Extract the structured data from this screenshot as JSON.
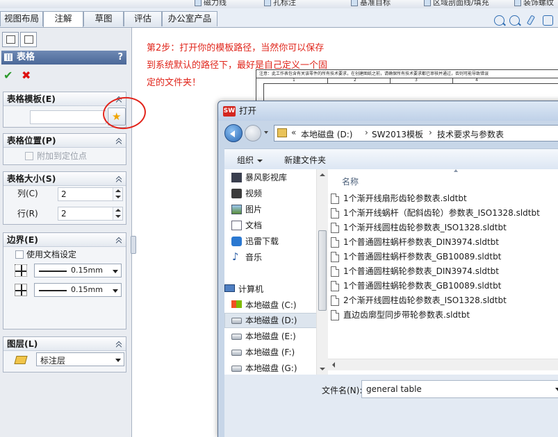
{
  "top_bar": {
    "commands": [
      "磁力线",
      "孔标注",
      "基准目标",
      "区域剖面线/填充",
      "装饰螺纹线"
    ],
    "tabs": [
      {
        "label": "视图布局",
        "active": false
      },
      {
        "label": "注解",
        "active": true
      },
      {
        "label": "草图",
        "active": false
      },
      {
        "label": "评估",
        "active": false
      },
      {
        "label": "办公室产品",
        "active": false
      }
    ]
  },
  "property_manager": {
    "title": "表格",
    "help": "?",
    "ok_icon": "✔",
    "cancel_icon": "✖",
    "groups": {
      "template": {
        "title": "表格模板(E)"
      },
      "position": {
        "title": "表格位置(P)",
        "attach_label": "附加到定位点",
        "attach_checked": false
      },
      "size": {
        "title": "表格大小(S)",
        "cols_label": "列(C)",
        "cols_value": "2",
        "rows_label": "行(R)",
        "rows_value": "2"
      },
      "border": {
        "title": "边界(E)",
        "use_doc_label": "使用文档设定",
        "use_doc_checked": false,
        "outer_value": "0.15mm",
        "inner_value": "0.15mm"
      },
      "layer": {
        "title": "图层(L)",
        "value": "标注层"
      }
    }
  },
  "annotation": {
    "note": "第2步：打开你的模板路径，当然你可以保存到系统默认的路径下，最好是自己定义一个固定的文件夹！",
    "highlight_color": "#e2231a"
  },
  "sheet": {
    "header_text": "注意：此工作表包含有关该零件的所有技术要求，在创建图纸之前，请确保所有技术要求都已审核并通过，否则可能导致错误",
    "ruler": [
      "1",
      "2",
      "3",
      "4"
    ]
  },
  "dialog": {
    "title": "打开",
    "app_badge": "SW",
    "breadcrumbs": [
      "本地磁盘 (D:)",
      "SW2013模板",
      "技术要求与参数表"
    ],
    "crumb_prefix": "«",
    "crumb_sep": "›",
    "organize_label": "组织",
    "new_folder_label": "新建文件夹",
    "nav": {
      "favorites": [
        {
          "label": "暴风影视库",
          "icon": "storm-video-icon"
        },
        {
          "label": "视频",
          "icon": "video-icon"
        },
        {
          "label": "图片",
          "icon": "picture-icon"
        },
        {
          "label": "文档",
          "icon": "document-icon"
        },
        {
          "label": "迅雷下载",
          "icon": "thunder-download-icon"
        },
        {
          "label": "音乐",
          "icon": "music-icon"
        }
      ],
      "computer": "计算机",
      "drives": [
        {
          "label": "本地磁盘 (C:)",
          "selected": false
        },
        {
          "label": "本地磁盘 (D:)",
          "selected": true
        },
        {
          "label": "本地磁盘 (E:)",
          "selected": false
        },
        {
          "label": "本地磁盘 (F:)",
          "selected": false
        },
        {
          "label": "本地磁盘 (G:)",
          "selected": false
        }
      ]
    },
    "column_name": "名称",
    "files": [
      "1个渐开线扇形齿轮参数表.sldtbt",
      "1个渐开线蜗杆（配斜齿轮）参数表_ISO1328.sldtbt",
      "1个渐开线圆柱齿轮参数表_ISO1328.sldtbt",
      "1个普通圆柱蜗杆参数表_DIN3974.sldtbt",
      "1个普通圆柱蜗杆参数表_GB10089.sldtbt",
      "1个普通圆柱蜗轮参数表_DIN3974.sldtbt",
      "1个普通圆柱蜗轮参数表_GB10089.sldtbt",
      "2个渐开线圆柱齿轮参数表_ISO1328.sldtbt",
      "直边齿廓型同步带轮参数表.sldtbt"
    ],
    "filename_label": "文件名(N):",
    "filename_value": "general table"
  }
}
